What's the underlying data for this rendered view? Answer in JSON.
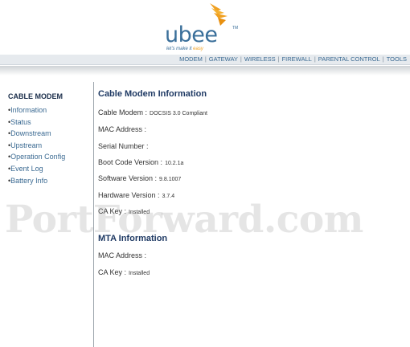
{
  "logo": {
    "word": "ubee",
    "tm": "TM",
    "tagline_pre": "let's make it ",
    "tagline_accent": "easy"
  },
  "nav": [
    "MODEM",
    "GATEWAY",
    "WIRELESS",
    "FIREWALL",
    "PARENTAL CONTROL",
    "TOOLS"
  ],
  "sidebar": {
    "title": "CABLE MODEM",
    "items": [
      "Information",
      "Status",
      "Downstream",
      "Upstream",
      "Operation Config",
      "Event Log",
      "Battery Info"
    ]
  },
  "cable_modem_info": {
    "title": "Cable Modem Information",
    "rows": [
      {
        "label": "Cable Modem :",
        "value": "DOCSIS 3.0 Compliant"
      },
      {
        "label": "MAC Address :",
        "value": ""
      },
      {
        "label": "Serial Number :",
        "value": ""
      },
      {
        "label": "Boot Code Version :",
        "value": "10.2.1a"
      },
      {
        "label": "Software Version :",
        "value": "9.8.1007"
      },
      {
        "label": "Hardware Version :",
        "value": "3.7.4"
      },
      {
        "label": "CA Key :",
        "value": "Installed"
      }
    ]
  },
  "mta_info": {
    "title": "MTA Information",
    "rows": [
      {
        "label": "MAC Address :",
        "value": ""
      },
      {
        "label": "CA Key :",
        "value": "Installed"
      }
    ]
  },
  "watermark": "PortForward.com",
  "colors": {
    "brand_blue": "#3a6f9a",
    "brand_orange": "#f0a020",
    "title_navy": "#1f3a64"
  }
}
